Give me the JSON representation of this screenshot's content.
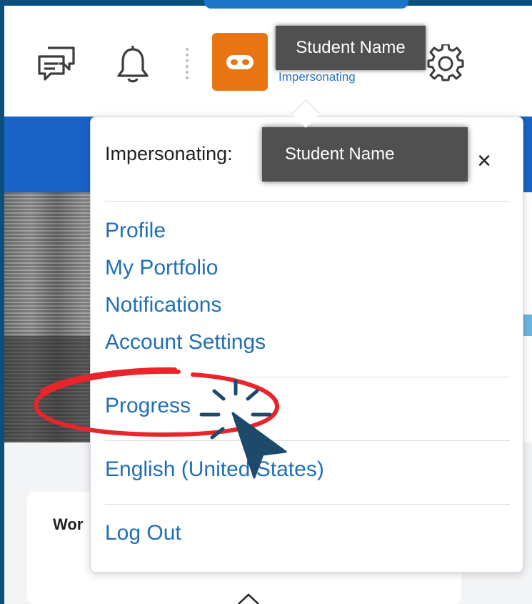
{
  "header": {
    "user_name": "Student Name",
    "status": "Impersonating",
    "icons": {
      "chat": "chat-bubbles-icon",
      "notifications": "bell-icon",
      "settings": "gear-icon",
      "avatar": "mask-icon"
    }
  },
  "dropdown": {
    "heading": "Impersonating:",
    "user_name": "Student Name",
    "close_label": "×",
    "links": {
      "profile": "Profile",
      "portfolio": "My Portfolio",
      "notifications": "Notifications",
      "account_settings": "Account Settings",
      "progress": "Progress",
      "language": "English (United States)",
      "logout": "Log Out"
    }
  },
  "card": {
    "title": "Wor"
  },
  "colors": {
    "frame": "#0b4f7b",
    "brand_blue": "#1a63c6",
    "avatar_orange": "#e87511",
    "link_blue": "#1f6fb7",
    "highlight_red": "#e8252b",
    "cursor_navy": "#1d4a6b"
  }
}
